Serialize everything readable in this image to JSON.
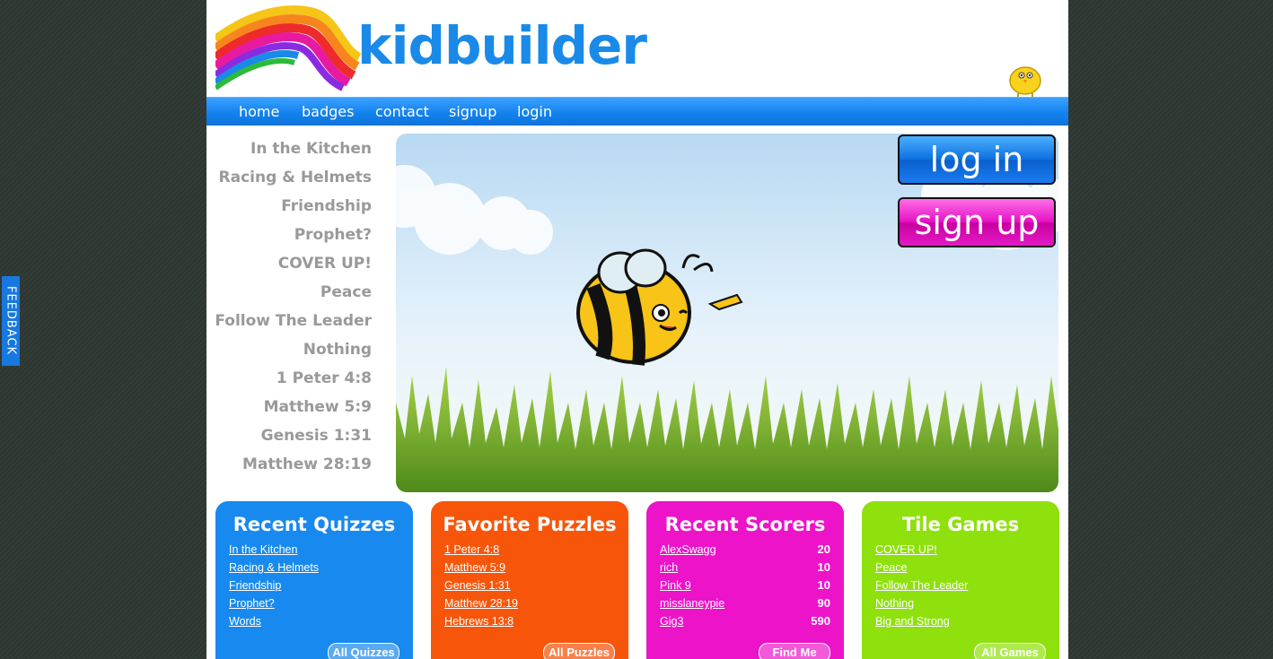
{
  "feedback": {
    "label": "FEEDBACK"
  },
  "brand": {
    "name": "kidbuilder"
  },
  "nav": {
    "items": [
      "home",
      "badges",
      "contact",
      "signup",
      "login"
    ]
  },
  "sidebar": {
    "items": [
      "In the Kitchen",
      "Racing & Helmets",
      "Friendship",
      "Prophet?",
      "COVER UP!",
      "Peace",
      "Follow The Leader",
      "Nothing",
      "1 Peter 4:8",
      "Matthew 5:9",
      "Genesis 1:31",
      "Matthew 28:19"
    ]
  },
  "hero": {
    "login_label": "log in",
    "signup_label": "sign up"
  },
  "cards": {
    "quizzes": {
      "title": "Recent Quizzes",
      "items": [
        "In the Kitchen",
        "Racing & Helmets",
        "Friendship",
        "Prophet?",
        "Words"
      ],
      "button": "All Quizzes"
    },
    "puzzles": {
      "title": "Favorite Puzzles",
      "items": [
        "1 Peter 4:8",
        "Matthew 5:9",
        "Genesis 1:31",
        "Matthew 28:19",
        "Hebrews 13:8"
      ],
      "button": "All Puzzles"
    },
    "scorers": {
      "title": "Recent Scorers",
      "items": [
        {
          "name": "AlexSwagg",
          "score": "20"
        },
        {
          "name": "rich",
          "score": "10"
        },
        {
          "name": "Pink 9",
          "score": "10"
        },
        {
          "name": "misslaneypie",
          "score": "90"
        },
        {
          "name": "Gig3",
          "score": "590"
        }
      ],
      "button": "Find Me"
    },
    "tiles": {
      "title": "Tile Games",
      "items": [
        "COVER UP!",
        "Peace",
        "Follow The Leader",
        "Nothing",
        "Big and Strong"
      ],
      "button": "All Games"
    }
  },
  "colors": {
    "brand_blue": "#1a8ae8",
    "nav_blue": "#1383ef",
    "card_blue": "#1889ef",
    "card_orange": "#f7560a",
    "card_pink": "#ec13c9",
    "card_green": "#8ee10d"
  }
}
